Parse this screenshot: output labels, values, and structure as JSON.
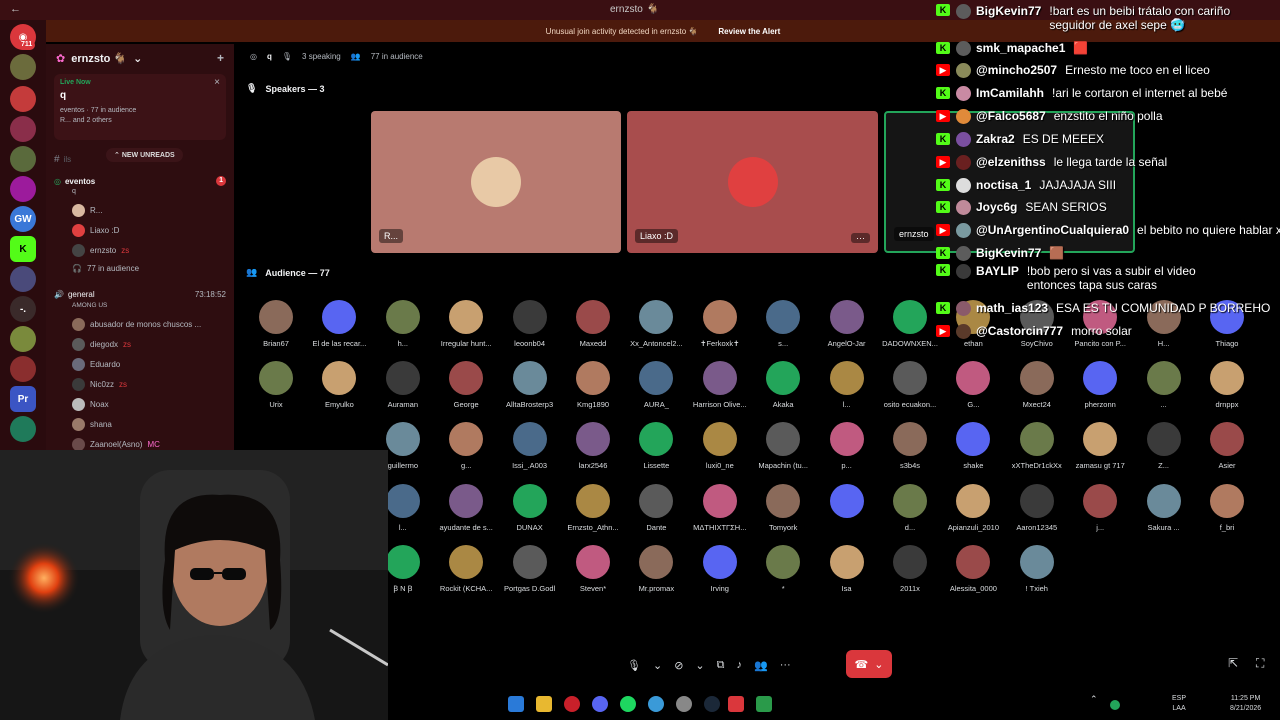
{
  "window": {
    "back": "←",
    "title": "ernzsto",
    "title_icon": "🐐"
  },
  "rail_badge": "711",
  "alert": {
    "text": "Unusual join activity detected in ernzsto 🐐",
    "action": "Review the Alert"
  },
  "server": {
    "name": "ernzsto 🐐"
  },
  "live_card": {
    "status": "Live Now",
    "stage_name": "q",
    "channel": "eventos",
    "audience": "77 in audience",
    "speakers": "R... and 2 others"
  },
  "new_unreads": "NEW UNREADS",
  "sidebar": {
    "faded_channel": "ils",
    "stage_channel": "eventos",
    "stage_topic": "q",
    "stage_users": [
      "R...",
      "Liaxo :D",
      "ernzsto"
    ],
    "stage_audience": "77 in audience",
    "voice_channel": "general",
    "voice_time": "73:18:52",
    "voice_activity": "AMONG US",
    "voice_users": [
      "abusador de monos chuscos ...",
      "diegodx",
      "Eduardo",
      "Nic0zz",
      "Noax",
      "shana",
      "Zaanoel(Asno)"
    ],
    "mc_tag": "MC",
    "zs_tag": "zs"
  },
  "stage": {
    "topic": "q",
    "speaking": "3 speaking",
    "audience_count": "77 in audience",
    "speakers_title": "Speakers — 3",
    "audience_title": "Audience — 77",
    "speakers": [
      {
        "name": "R...",
        "bg": "#b87a70",
        "av": "#e8c9a6"
      },
      {
        "name": "Liaxo :D",
        "bg": "#a84d4d",
        "av": "#e04040"
      },
      {
        "name": "ernzsto",
        "bg": "#1a1a1a",
        "av": "#2a2a2a"
      }
    ],
    "more": "···",
    "audience": [
      [
        "Brian67",
        "El de las recar...",
        "h...",
        "Irregular hunt...",
        "leoonb04",
        "Maxedd",
        "Xx_Antoncel2...",
        "✝Ferkoxk✝",
        "s...",
        "AngelO-Jar",
        "DADOWNXEN...",
        "ethan",
        "SoyChivo",
        "Pancito con P...",
        "H...",
        "Thiago"
      ],
      [
        "Urix",
        "Emyulko",
        "Auraman",
        "George",
        "AlltaBrosterp3",
        "Kmg1890",
        "AURA_",
        "Harrison Olive...",
        "Akaka",
        "l...",
        "osito ecuakon...",
        "G...",
        "Mxect24",
        "pherzonn",
        "...",
        "drnppx"
      ],
      [
        "",
        "",
        "guillermo",
        "g...",
        "Issi_.A003",
        "larx2546",
        "Lissette",
        "luxi0_ne",
        "Mapachin (tu...",
        "p...",
        "s3b4s",
        "shake",
        "xXTheDr1ckXx",
        "zamasu gt 717",
        "Z...",
        "Asier"
      ],
      [
        "",
        "",
        "l...",
        "ayudante de s...",
        "DUNAX",
        "Ernzsto_Athn...",
        "Dante",
        "MΔTHIXTΓΣH...",
        "Tomyork",
        "",
        "d...",
        "Apianzuli_2010",
        "Aaron12345",
        "j...",
        "Sakura ...",
        "f_bri"
      ],
      [
        "",
        "",
        "Ꞵ N Ꞵ",
        "Rockit (KCHA...",
        "Portgas D.Godl",
        "Steven*",
        "Mr.promax",
        "Irving",
        "*",
        "Isa",
        "2011x",
        "Alessita_0000",
        "! Txieh"
      ]
    ]
  },
  "controls": {
    "mic": "🎙",
    "caret": "⌄",
    "cam_off": "⊘",
    "share": "⧉",
    "sound": "♪",
    "invite": "👥",
    "more": "···",
    "hangup": "☎"
  },
  "chat": [
    {
      "p": "k",
      "u": "BigKevin77",
      "t": "!bart es un beibi trátalo con cariño seguidor de axel sepe 🥶",
      "ic": "#5c5c5c"
    },
    {
      "p": "k",
      "u": "smk_mapache1",
      "t": "🟥",
      "ic": "#5c5c5c"
    },
    {
      "p": "y",
      "u": "@mincho2507",
      "t": "Ernesto me toco en el liceo",
      "ic": "#8a8a5a"
    },
    {
      "p": "k",
      "u": "ImCamilahh",
      "t": "!ari le cortaron el internet al bebé",
      "ic": "#c98aa3"
    },
    {
      "p": "y",
      "u": "@Falco5687",
      "t": "enzstito el niño polla",
      "ic": "#e08a3a"
    },
    {
      "p": "k",
      "u": "Zakra2",
      "t": "ES DE MEEEX",
      "ic": "#7a4fa0"
    },
    {
      "p": "y",
      "u": "@elzenithss",
      "t": "le llega tarde la señal",
      "ic": "#6a2020"
    },
    {
      "p": "k",
      "u": "noctisa_1",
      "t": "JAJAJAJA SIII",
      "ic": "#ddd"
    },
    {
      "p": "k",
      "u": "Joyc6g",
      "t": "SEAN SERIOS",
      "ic": "#c08a9a"
    },
    {
      "p": "y",
      "u": "@UnArgentinoCualquiera0",
      "t": "el bebito no quiere hablar xd",
      "ic": "#7a9aa0"
    },
    {
      "p": "k",
      "u": "BigKevin77",
      "t": "🟫",
      "ic": "#5c5c5c"
    },
    {
      "p": "k",
      "u": "BAYLIP",
      "t": "!bob pero si vas a subir el video entonces tapa sus caras",
      "ic": "#3a3a3a"
    },
    {
      "p": "k",
      "u": "math_ias123",
      "t": "ESA ES TU COMUNIDAD P BORREHO",
      "ic": "#8a5a6a"
    },
    {
      "p": "y",
      "u": "@Castorcin777",
      "t": "morro solar",
      "ic": "#5a3a2a"
    }
  ],
  "tray": {
    "lang": "ESP",
    "layout": "LAA",
    "time": "11:25 PM",
    "date": "8/21/2026"
  },
  "colors": {
    "kick": "#53fc18",
    "youtube": "#ff0000",
    "discord": "#5865f2",
    "hangup": "#da373c"
  }
}
